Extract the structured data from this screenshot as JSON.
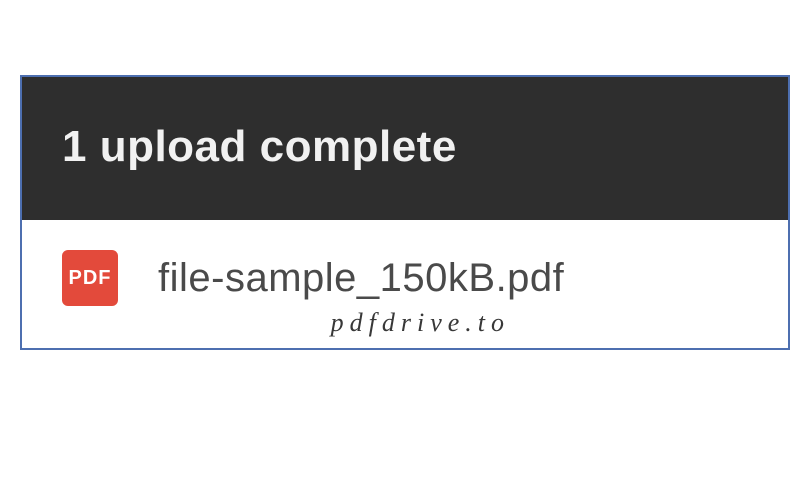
{
  "upload": {
    "header_title": "1 upload complete",
    "file": {
      "icon_label": "PDF",
      "name": "file-sample_150kB.pdf"
    }
  },
  "watermark": "pdfdrive.to"
}
